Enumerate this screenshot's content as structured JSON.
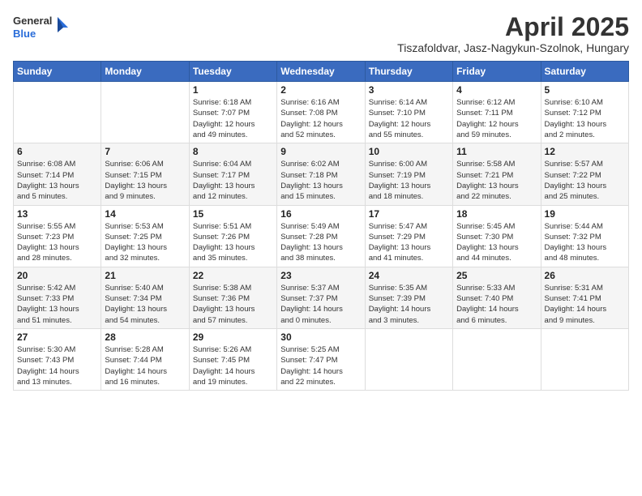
{
  "header": {
    "logo_general": "General",
    "logo_blue": "Blue",
    "month_title": "April 2025",
    "location": "Tiszafoldvar, Jasz-Nagykun-Szolnok, Hungary"
  },
  "weekdays": [
    "Sunday",
    "Monday",
    "Tuesday",
    "Wednesday",
    "Thursday",
    "Friday",
    "Saturday"
  ],
  "weeks": [
    [
      {
        "day": "",
        "info": ""
      },
      {
        "day": "",
        "info": ""
      },
      {
        "day": "1",
        "info": "Sunrise: 6:18 AM\nSunset: 7:07 PM\nDaylight: 12 hours\nand 49 minutes."
      },
      {
        "day": "2",
        "info": "Sunrise: 6:16 AM\nSunset: 7:08 PM\nDaylight: 12 hours\nand 52 minutes."
      },
      {
        "day": "3",
        "info": "Sunrise: 6:14 AM\nSunset: 7:10 PM\nDaylight: 12 hours\nand 55 minutes."
      },
      {
        "day": "4",
        "info": "Sunrise: 6:12 AM\nSunset: 7:11 PM\nDaylight: 12 hours\nand 59 minutes."
      },
      {
        "day": "5",
        "info": "Sunrise: 6:10 AM\nSunset: 7:12 PM\nDaylight: 13 hours\nand 2 minutes."
      }
    ],
    [
      {
        "day": "6",
        "info": "Sunrise: 6:08 AM\nSunset: 7:14 PM\nDaylight: 13 hours\nand 5 minutes."
      },
      {
        "day": "7",
        "info": "Sunrise: 6:06 AM\nSunset: 7:15 PM\nDaylight: 13 hours\nand 9 minutes."
      },
      {
        "day": "8",
        "info": "Sunrise: 6:04 AM\nSunset: 7:17 PM\nDaylight: 13 hours\nand 12 minutes."
      },
      {
        "day": "9",
        "info": "Sunrise: 6:02 AM\nSunset: 7:18 PM\nDaylight: 13 hours\nand 15 minutes."
      },
      {
        "day": "10",
        "info": "Sunrise: 6:00 AM\nSunset: 7:19 PM\nDaylight: 13 hours\nand 18 minutes."
      },
      {
        "day": "11",
        "info": "Sunrise: 5:58 AM\nSunset: 7:21 PM\nDaylight: 13 hours\nand 22 minutes."
      },
      {
        "day": "12",
        "info": "Sunrise: 5:57 AM\nSunset: 7:22 PM\nDaylight: 13 hours\nand 25 minutes."
      }
    ],
    [
      {
        "day": "13",
        "info": "Sunrise: 5:55 AM\nSunset: 7:23 PM\nDaylight: 13 hours\nand 28 minutes."
      },
      {
        "day": "14",
        "info": "Sunrise: 5:53 AM\nSunset: 7:25 PM\nDaylight: 13 hours\nand 32 minutes."
      },
      {
        "day": "15",
        "info": "Sunrise: 5:51 AM\nSunset: 7:26 PM\nDaylight: 13 hours\nand 35 minutes."
      },
      {
        "day": "16",
        "info": "Sunrise: 5:49 AM\nSunset: 7:28 PM\nDaylight: 13 hours\nand 38 minutes."
      },
      {
        "day": "17",
        "info": "Sunrise: 5:47 AM\nSunset: 7:29 PM\nDaylight: 13 hours\nand 41 minutes."
      },
      {
        "day": "18",
        "info": "Sunrise: 5:45 AM\nSunset: 7:30 PM\nDaylight: 13 hours\nand 44 minutes."
      },
      {
        "day": "19",
        "info": "Sunrise: 5:44 AM\nSunset: 7:32 PM\nDaylight: 13 hours\nand 48 minutes."
      }
    ],
    [
      {
        "day": "20",
        "info": "Sunrise: 5:42 AM\nSunset: 7:33 PM\nDaylight: 13 hours\nand 51 minutes."
      },
      {
        "day": "21",
        "info": "Sunrise: 5:40 AM\nSunset: 7:34 PM\nDaylight: 13 hours\nand 54 minutes."
      },
      {
        "day": "22",
        "info": "Sunrise: 5:38 AM\nSunset: 7:36 PM\nDaylight: 13 hours\nand 57 minutes."
      },
      {
        "day": "23",
        "info": "Sunrise: 5:37 AM\nSunset: 7:37 PM\nDaylight: 14 hours\nand 0 minutes."
      },
      {
        "day": "24",
        "info": "Sunrise: 5:35 AM\nSunset: 7:39 PM\nDaylight: 14 hours\nand 3 minutes."
      },
      {
        "day": "25",
        "info": "Sunrise: 5:33 AM\nSunset: 7:40 PM\nDaylight: 14 hours\nand 6 minutes."
      },
      {
        "day": "26",
        "info": "Sunrise: 5:31 AM\nSunset: 7:41 PM\nDaylight: 14 hours\nand 9 minutes."
      }
    ],
    [
      {
        "day": "27",
        "info": "Sunrise: 5:30 AM\nSunset: 7:43 PM\nDaylight: 14 hours\nand 13 minutes."
      },
      {
        "day": "28",
        "info": "Sunrise: 5:28 AM\nSunset: 7:44 PM\nDaylight: 14 hours\nand 16 minutes."
      },
      {
        "day": "29",
        "info": "Sunrise: 5:26 AM\nSunset: 7:45 PM\nDaylight: 14 hours\nand 19 minutes."
      },
      {
        "day": "30",
        "info": "Sunrise: 5:25 AM\nSunset: 7:47 PM\nDaylight: 14 hours\nand 22 minutes."
      },
      {
        "day": "",
        "info": ""
      },
      {
        "day": "",
        "info": ""
      },
      {
        "day": "",
        "info": ""
      }
    ]
  ]
}
